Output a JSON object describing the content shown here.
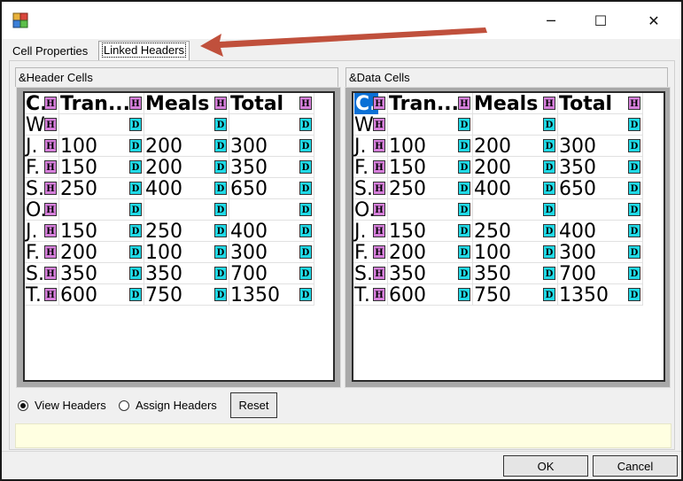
{
  "window": {
    "min_glyph": "─",
    "max_glyph": "☐",
    "close_glyph": "✕"
  },
  "tabs": [
    {
      "label": "Cell Properties",
      "selected": false
    },
    {
      "label": "Linked Headers",
      "selected": true
    }
  ],
  "groups": {
    "left_title": "&Header Cells",
    "right_title": "&Data Cells"
  },
  "grid": {
    "rows": [
      {
        "cells": [
          "C.",
          "Tran...",
          "Meals",
          "Total"
        ],
        "badges": [
          "H",
          "H",
          "H",
          "H"
        ]
      },
      {
        "cells": [
          "W",
          "",
          "",
          ""
        ],
        "badges": [
          "H",
          "D",
          "D",
          "D"
        ]
      },
      {
        "cells": [
          "J.",
          "100",
          "200",
          "300"
        ],
        "badges": [
          "H",
          "D",
          "D",
          "D"
        ]
      },
      {
        "cells": [
          "F.",
          "150",
          "200",
          "350"
        ],
        "badges": [
          "H",
          "D",
          "D",
          "D"
        ]
      },
      {
        "cells": [
          "S.",
          "250",
          "400",
          "650"
        ],
        "badges": [
          "H",
          "D",
          "D",
          "D"
        ]
      },
      {
        "cells": [
          "O.",
          "",
          "",
          ""
        ],
        "badges": [
          "H",
          "D",
          "D",
          "D"
        ]
      },
      {
        "cells": [
          "J.",
          "150",
          "250",
          "400"
        ],
        "badges": [
          "H",
          "D",
          "D",
          "D"
        ]
      },
      {
        "cells": [
          "F.",
          "200",
          "100",
          "300"
        ],
        "badges": [
          "H",
          "D",
          "D",
          "D"
        ]
      },
      {
        "cells": [
          "S.",
          "350",
          "350",
          "700"
        ],
        "badges": [
          "H",
          "D",
          "D",
          "D"
        ]
      },
      {
        "cells": [
          "T.",
          "600",
          "750",
          "1350"
        ],
        "badges": [
          "H",
          "D",
          "D",
          "D"
        ]
      }
    ],
    "right_selected_cell": "C."
  },
  "controls": {
    "view_headers": {
      "label": "View Headers",
      "checked": true
    },
    "assign_headers": {
      "label": "Assign Headers",
      "checked": false
    },
    "reset": "Reset"
  },
  "buttons": {
    "ok": "OK",
    "cancel": "Cancel"
  },
  "colors": {
    "header_badge": "#d67fdb",
    "data_badge": "#1fd9e6",
    "selection": "#0a70d6",
    "arrow": "#c0503c",
    "status_bar": "#ffffe1"
  }
}
